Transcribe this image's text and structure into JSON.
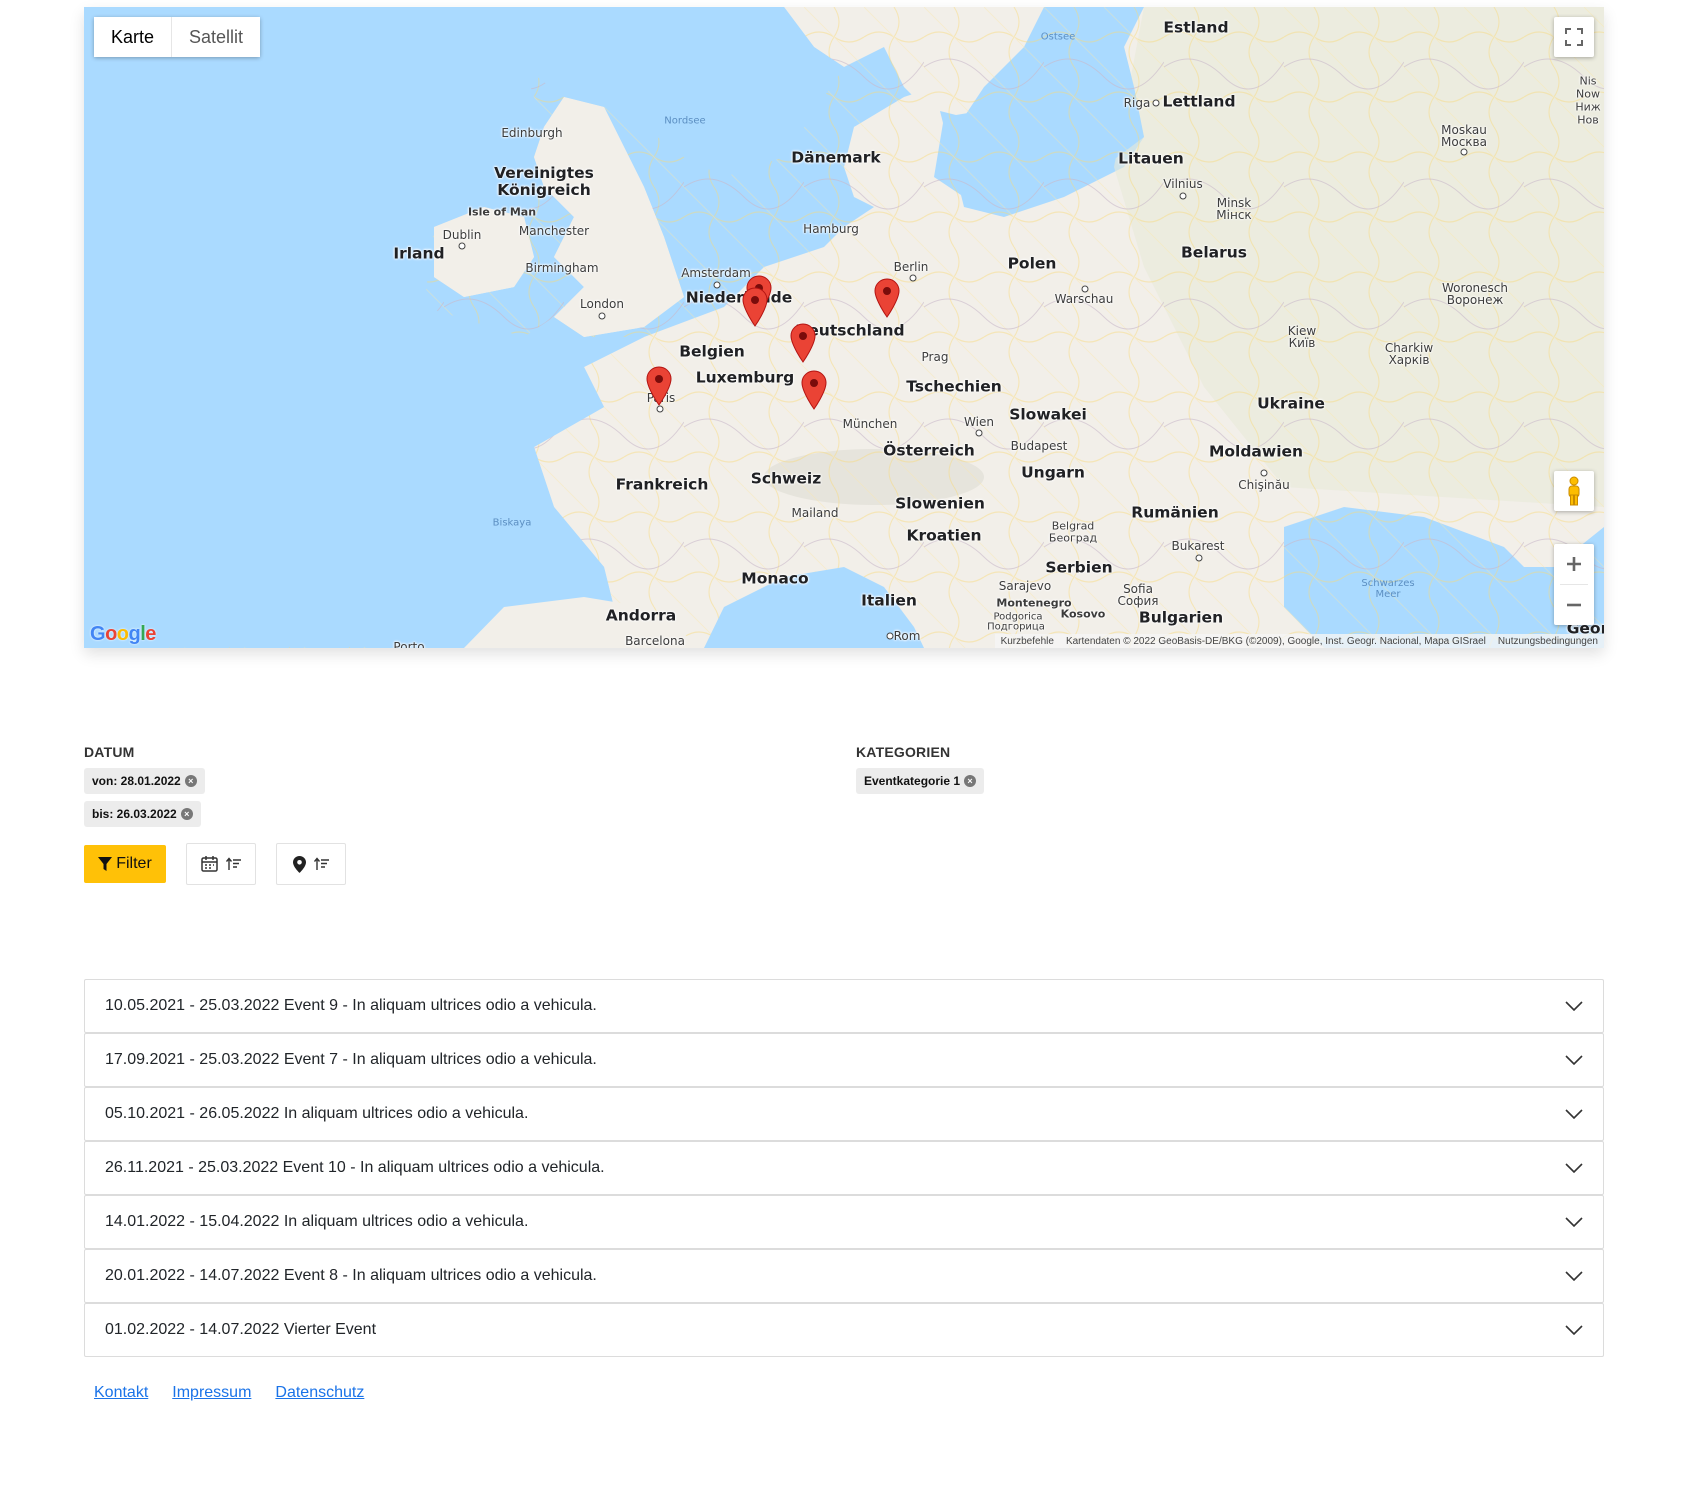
{
  "map": {
    "type_buttons": {
      "map": "Karte",
      "satellite": "Satellit"
    },
    "logo": "Google",
    "attribution": {
      "shortcuts": "Kurzbefehle",
      "data": "Kartendaten © 2022 GeoBasis-DE/BKG (©2009), Google, Inst. Geogr. Nacional, Mapa GISrael",
      "terms": "Nutzungsbedingungen"
    },
    "labels": {
      "estland": "Estland",
      "lettland": "Lettland",
      "litauen": "Litauen",
      "belarus": "Belarus",
      "polen": "Polen",
      "daenemark": "Dänemark",
      "vereinigtes": "Vereinigtes\nKönigreich",
      "irland": "Irland",
      "niederlande": "Niederlande",
      "belgien": "Belgien",
      "luxemburg": "Luxemburg",
      "deutschland": "Deutschland",
      "tschechien": "Tschechien",
      "slowakei": "Slowakei",
      "ukraine": "Ukraine",
      "oesterreich": "Österreich",
      "ungarn": "Ungarn",
      "moldawien": "Moldawien",
      "rumaenien": "Rumänien",
      "frankreich": "Frankreich",
      "schweiz": "Schweiz",
      "slowenien": "Slowenien",
      "kroatien": "Kroatien",
      "serbien": "Serbien",
      "bulgarien": "Bulgarien",
      "italien": "Italien",
      "monaco": "Monaco",
      "andorra": "Andorra",
      "edinburgh": "Edinburgh",
      "isle_of_man": "Isle of Man",
      "dublin": "Dublin",
      "manchester": "Manchester",
      "birmingham": "Birmingham",
      "london": "London",
      "amsterdam": "Amsterdam",
      "hamburg": "Hamburg",
      "berlin": "Berlin",
      "paris": "Paris",
      "prag": "Prag",
      "muenchen": "München",
      "wien": "Wien",
      "budapest": "Budapest",
      "mailand": "Mailand",
      "warschau": "Warschau",
      "riga": "Riga",
      "vilnius": "Vilnius",
      "minsk": "Minsk",
      "minsk_cy": "Мінск",
      "kiew": "Kiew",
      "kiew_cy": "Київ",
      "moskau": "Moskau",
      "moskau_cy": "Москва",
      "woronesch": "Woronesch",
      "woronesch_cy": "Воронеж",
      "charkiw": "Charkiw",
      "charkiw_cy": "Харків",
      "chisinau": "Chişinău",
      "belgrad": "Belgrad",
      "belgrad_cy": "Београд",
      "bukarest": "Bukarest",
      "sarajevo": "Sarajevo",
      "montenegro": "Montenegro",
      "podgorica": "Podgorica",
      "podgorica_cy": "Подгорица",
      "kosovo": "Kosovo",
      "sofia": "Sofia",
      "sofia_cy": "София",
      "rom": "Rom",
      "barcelona": "Barcelona",
      "porto": "Porto",
      "nordsee": "Nordsee",
      "ostsee": "Ostsee",
      "biskaya": "Biskaya",
      "schwarzes_meer": "Schwarzes\nMeer",
      "georgien": "Georg",
      "edge_ru_1": "Nis",
      "edge_ru_2": "Now",
      "edge_ru_3": "Ниж",
      "edge_ru_4": "Нов"
    }
  },
  "filters": {
    "date": {
      "heading": "DATUM",
      "from": "von: 28.01.2022",
      "to": "bis: 26.03.2022"
    },
    "categories": {
      "heading": "KATEGORIEN",
      "chip": "Eventkategorie 1"
    },
    "filter_button": "Filter",
    "remove_icon": "×"
  },
  "events": [
    "10.05.2021 - 25.03.2022 Event 9 - In aliquam ultrices odio a vehicula.",
    "17.09.2021 - 25.03.2022 Event 7 - In aliquam ultrices odio a vehicula.",
    "05.10.2021 - 26.05.2022 In aliquam ultrices odio a vehicula.",
    "26.11.2021 - 25.03.2022 Event 10 - In aliquam ultrices odio a vehicula.",
    "14.01.2022 - 15.04.2022 In aliquam ultrices odio a vehicula.",
    "20.01.2022 - 14.07.2022 Event 8 - In aliquam ultrices odio a vehicula.",
    "01.02.2022 - 14.07.2022 Vierter Event"
  ],
  "footer": {
    "contact": "Kontakt",
    "imprint": "Impressum",
    "privacy": "Datenschutz"
  },
  "colors": {
    "accent": "#ffc107",
    "link": "#1a73e8",
    "pin": "#ea4335",
    "water": "#aadaff",
    "land": "#f2efe9"
  }
}
